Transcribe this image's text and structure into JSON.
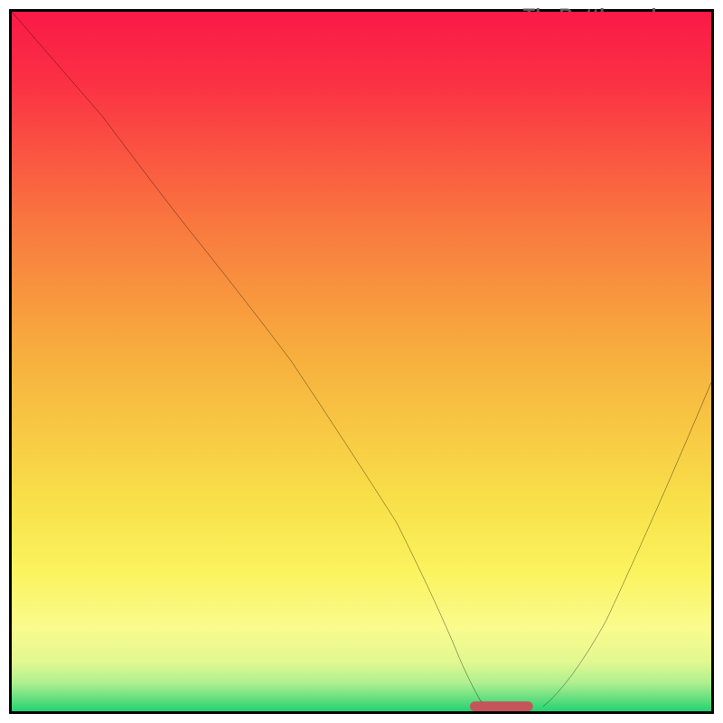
{
  "watermark": "TheBottleneck.com",
  "chart_data": {
    "type": "line",
    "title": "",
    "xlabel": "",
    "ylabel": "",
    "xlim": [
      0,
      100
    ],
    "ylim": [
      0,
      100
    ],
    "gradient_stops": [
      {
        "pct": 0,
        "color": "#fa1a47"
      },
      {
        "pct": 10,
        "color": "#fb3044"
      },
      {
        "pct": 30,
        "color": "#f9773f"
      },
      {
        "pct": 50,
        "color": "#f7b13e"
      },
      {
        "pct": 70,
        "color": "#f8e049"
      },
      {
        "pct": 80,
        "color": "#fbf35e"
      },
      {
        "pct": 88,
        "color": "#fafb8d"
      },
      {
        "pct": 93,
        "color": "#e1f891"
      },
      {
        "pct": 96,
        "color": "#aeef8f"
      },
      {
        "pct": 98,
        "color": "#6be081"
      },
      {
        "pct": 100,
        "color": "#23d373"
      }
    ],
    "series": [
      {
        "name": "bottleneck-curve",
        "x": [
          0,
          13,
          22,
          30,
          40,
          48,
          55,
          60,
          63,
          65,
          68,
          73,
          78,
          85,
          92,
          100
        ],
        "y": [
          100,
          85,
          73,
          65,
          50,
          38,
          27,
          17,
          10,
          5,
          1,
          0,
          3,
          13,
          28,
          47
        ]
      }
    ],
    "optimum_marker": {
      "x": 70,
      "width": 9,
      "y": 0.5
    }
  }
}
